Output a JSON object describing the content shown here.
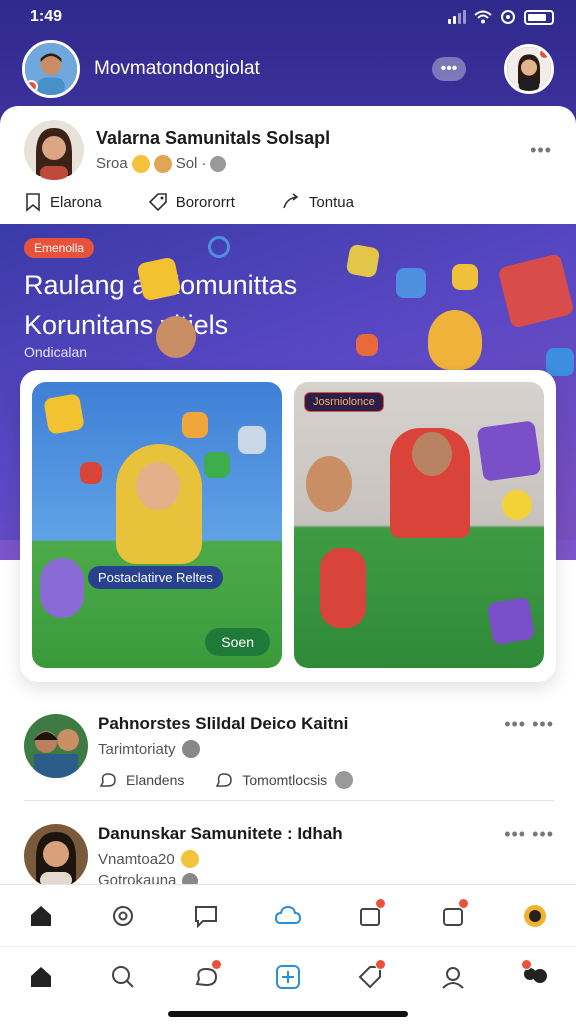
{
  "status": {
    "time": "1:49"
  },
  "header": {
    "title": "Movmatondongiolat",
    "more": "•••"
  },
  "post": {
    "name": "Valarna Samunitals Solsapl",
    "meta": "Sroa",
    "meta2": "Sol",
    "actions": [
      {
        "label": "Elarona",
        "icon": "bookmark-icon"
      },
      {
        "label": "Borororrt",
        "icon": "tag-icon"
      },
      {
        "label": "Tontua",
        "icon": "share-icon"
      }
    ]
  },
  "banner": {
    "badge": "Emenolla",
    "title1": "Raulang anKomunittas",
    "title2": "Korunitans vitiels",
    "subtitle": "Ondicalan"
  },
  "tiles": {
    "left_label": "Postaclatirve Reltes",
    "left_button": "Soen",
    "right_tag": "Josrniolonce"
  },
  "feed": [
    {
      "name": "Pahnorstes Slildal Deico Kaitni",
      "sub": "Tarimtoriaty",
      "actions": [
        "Elandens",
        "Tomomtlocsis"
      ]
    },
    {
      "name": "Danunskar Samunitete : Idhah",
      "sub": "Vnamtoa20",
      "sub2": "Gotrokauna"
    }
  ],
  "colors": {
    "accent": "#e8523b",
    "brand": "#3b2f9a",
    "green": "#1f7a3a"
  }
}
